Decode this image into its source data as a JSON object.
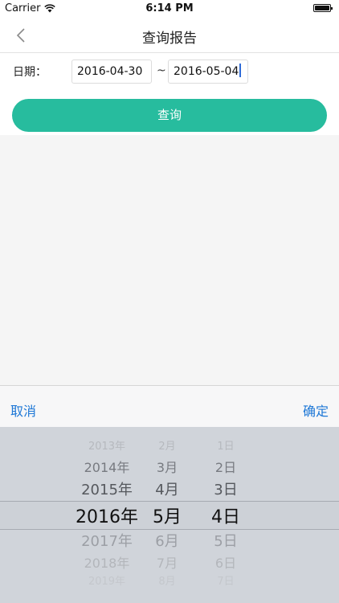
{
  "status_bar": {
    "carrier": "Carrier",
    "time": "6:14 PM"
  },
  "nav": {
    "title": "查询报告"
  },
  "form": {
    "date_label": "日期：",
    "start_date": "2016-04-30",
    "separator": "~",
    "end_date": "2016-05-04",
    "query_label": "查询"
  },
  "picker_toolbar": {
    "cancel": "取消",
    "confirm": "确定"
  },
  "picker": {
    "years": [
      "2013年",
      "2014年",
      "2015年",
      "2016年",
      "2017年",
      "2018年",
      "2019年"
    ],
    "months": [
      "2月",
      "3月",
      "4月",
      "5月",
      "6月",
      "7月",
      "8月"
    ],
    "days": [
      "1日",
      "2日",
      "3日",
      "4日",
      "5日",
      "6日",
      "7日"
    ],
    "selected": {
      "year": "2016年",
      "month": "5月",
      "day": "4日"
    }
  },
  "colors": {
    "accent": "#27bc9e",
    "link": "#1d77d6",
    "picker_bg": "#d0d4da"
  }
}
